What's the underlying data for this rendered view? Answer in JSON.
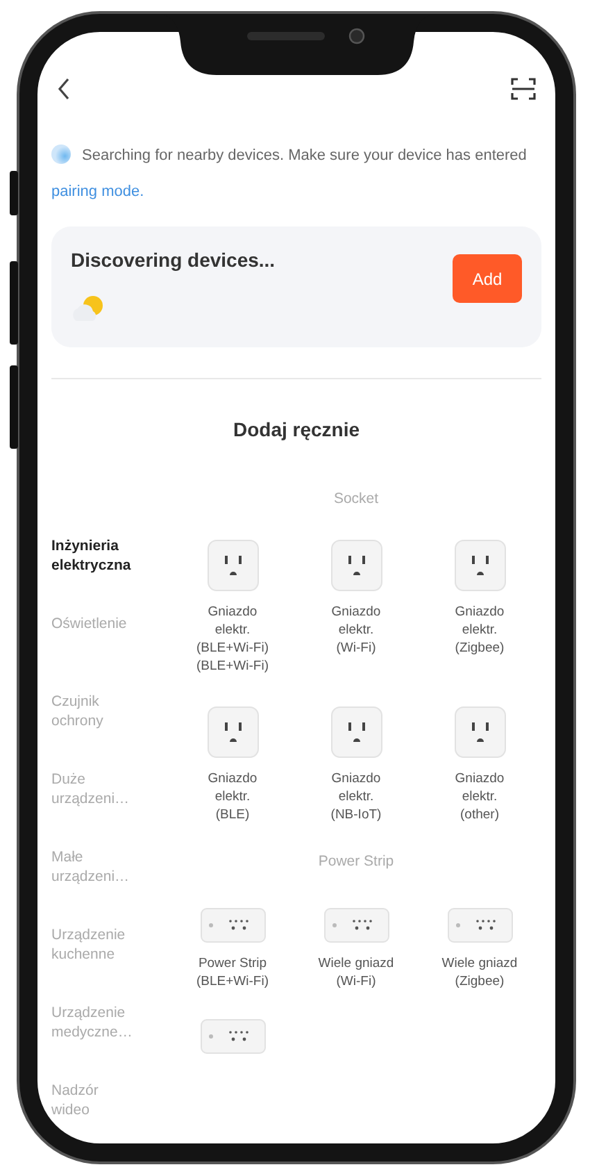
{
  "notice": {
    "text": "Searching for nearby devices. Make sure your device has entered",
    "link": "pairing mode."
  },
  "discovery": {
    "title": "Discovering devices...",
    "button": "Add"
  },
  "section_title": "Dodaj ręcznie",
  "categories": [
    {
      "lines": [
        "Inżynieria",
        "elektryczna"
      ],
      "selected": true
    },
    {
      "lines": [
        "Oświetlenie"
      ],
      "selected": false
    },
    {
      "lines": [
        "Czujnik",
        "ochrony"
      ],
      "selected": false
    },
    {
      "lines": [
        "Duże",
        "urządzeni…"
      ],
      "selected": false
    },
    {
      "lines": [
        "Małe",
        "urządzeni…"
      ],
      "selected": false
    },
    {
      "lines": [
        "Urządzenie",
        "kuchenne"
      ],
      "selected": false
    },
    {
      "lines": [
        "Urządzenie",
        "medyczne…"
      ],
      "selected": false
    },
    {
      "lines": [
        "Nadzór",
        "wideo"
      ],
      "selected": false
    }
  ],
  "groups": [
    {
      "title": "Socket",
      "devices": [
        {
          "kind": "socket",
          "lines": [
            "Gniazdo",
            "elektr.",
            "(BLE+Wi-Fi)",
            "(BLE+Wi-Fi)"
          ]
        },
        {
          "kind": "socket",
          "lines": [
            "Gniazdo",
            "elektr.",
            "(Wi-Fi)"
          ]
        },
        {
          "kind": "socket",
          "lines": [
            "Gniazdo",
            "elektr.",
            "(Zigbee)"
          ]
        },
        {
          "kind": "socket",
          "lines": [
            "Gniazdo",
            "elektr.",
            "(BLE)"
          ]
        },
        {
          "kind": "socket",
          "lines": [
            "Gniazdo",
            "elektr.",
            "(NB-IoT)"
          ]
        },
        {
          "kind": "socket",
          "lines": [
            "Gniazdo",
            "elektr.",
            "(other)"
          ]
        }
      ]
    },
    {
      "title": "Power Strip",
      "devices": [
        {
          "kind": "strip",
          "lines": [
            "Power Strip",
            "(BLE+Wi-Fi)"
          ]
        },
        {
          "kind": "strip",
          "lines": [
            "Wiele gniazd",
            "(Wi-Fi)"
          ]
        },
        {
          "kind": "strip",
          "lines": [
            "Wiele gniazd",
            "(Zigbee)"
          ]
        },
        {
          "kind": "strip"
        }
      ]
    }
  ]
}
